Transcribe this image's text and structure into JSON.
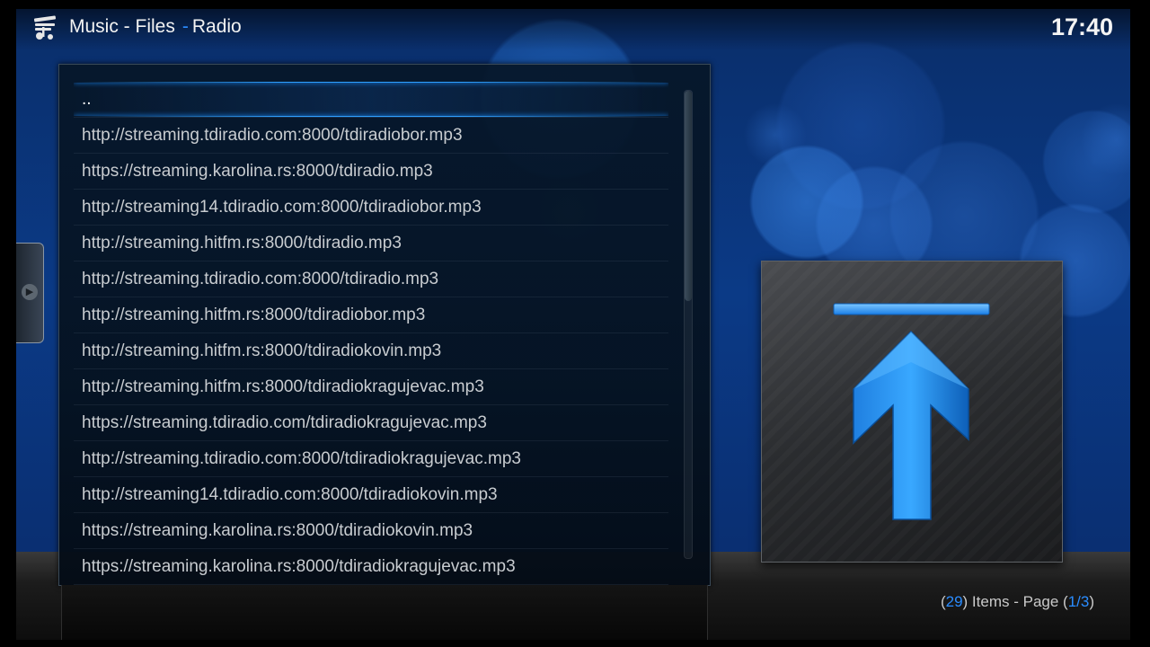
{
  "header": {
    "section": "Music - Files",
    "separator": "-",
    "subsection": "Radio",
    "clock": "17:40",
    "logo_icon": "kodi-music-icon"
  },
  "list": {
    "items": [
      "..",
      "http://streaming.tdiradio.com:8000/tdiradiobor.mp3",
      "https://streaming.karolina.rs:8000/tdiradio.mp3",
      "http://streaming14.tdiradio.com:8000/tdiradiobor.mp3",
      "http://streaming.hitfm.rs:8000/tdiradio.mp3",
      "http://streaming.tdiradio.com:8000/tdiradio.mp3",
      "http://streaming.hitfm.rs:8000/tdiradiobor.mp3",
      "http://streaming.hitfm.rs:8000/tdiradiokovin.mp3",
      "http://streaming.hitfm.rs:8000/tdiradiokragujevac.mp3",
      "https://streaming.tdiradio.com/tdiradiokragujevac.mp3",
      "http://streaming.tdiradio.com:8000/tdiradiokragujevac.mp3",
      "http://streaming14.tdiradio.com:8000/tdiradiokovin.mp3",
      "https://streaming.karolina.rs:8000/tdiradiokovin.mp3",
      "https://streaming.karolina.rs:8000/tdiradiokragujevac.mp3"
    ],
    "focused_index": 0,
    "scroll_fraction_visible": 0.45
  },
  "thumbnail": {
    "icon": "folder-up-arrow-icon",
    "accent": "#1f8fff"
  },
  "footer": {
    "open_paren": "(",
    "item_count": "29",
    "items_label": ") Items - Page (",
    "page": "1/3",
    "close_paren": ")"
  },
  "colors": {
    "accent": "#2a8cff",
    "background": "#0b3a86"
  }
}
